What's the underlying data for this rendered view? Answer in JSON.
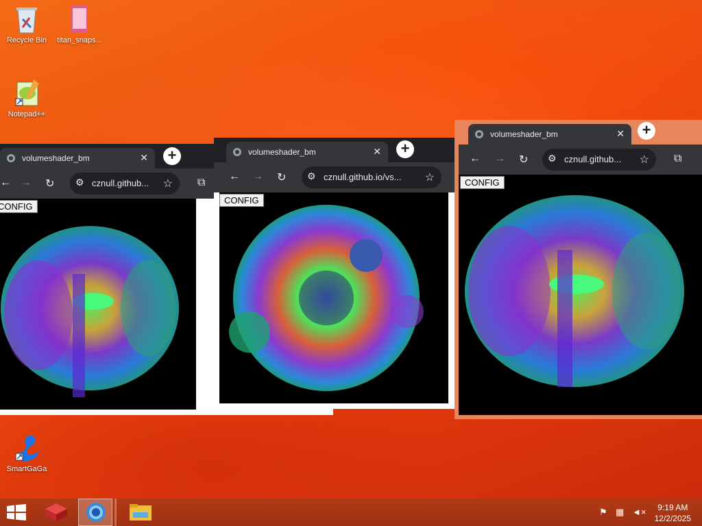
{
  "desktop": {
    "icons": [
      {
        "label": "Recycle Bin",
        "icon": "recycle-bin-icon"
      },
      {
        "label": "titan_snaps...",
        "icon": "phone-image-icon"
      },
      {
        "label": "Notepad++",
        "icon": "notepad-plus-plus-icon"
      },
      {
        "label": "SmartGaGa",
        "icon": "swan-icon"
      }
    ]
  },
  "windows": [
    {
      "tab_title": "volumeshader_bm",
      "url": "cznull.github...",
      "button": "CONFIG"
    },
    {
      "tab_title": "volumeshader_bm",
      "url": "cznull.github.io/vs...",
      "button": "CONFIG"
    },
    {
      "tab_title": "volumeshader_bm",
      "url": "cznull.github...",
      "button": "CONFIG"
    }
  ],
  "browser": {
    "back": "←",
    "forward": "→",
    "reload": "↻",
    "new_tab": "+",
    "close": "✕",
    "star": "☆",
    "extensions": "⧉"
  },
  "taskbar": {
    "start_icon": "windows-start-icon",
    "time": "9:19 AM",
    "date": "12/2/2025"
  },
  "colors": {
    "accent_border": "#e8855c",
    "desktop_orange": "#ec4a0e",
    "taskbar": "#a8351a"
  }
}
